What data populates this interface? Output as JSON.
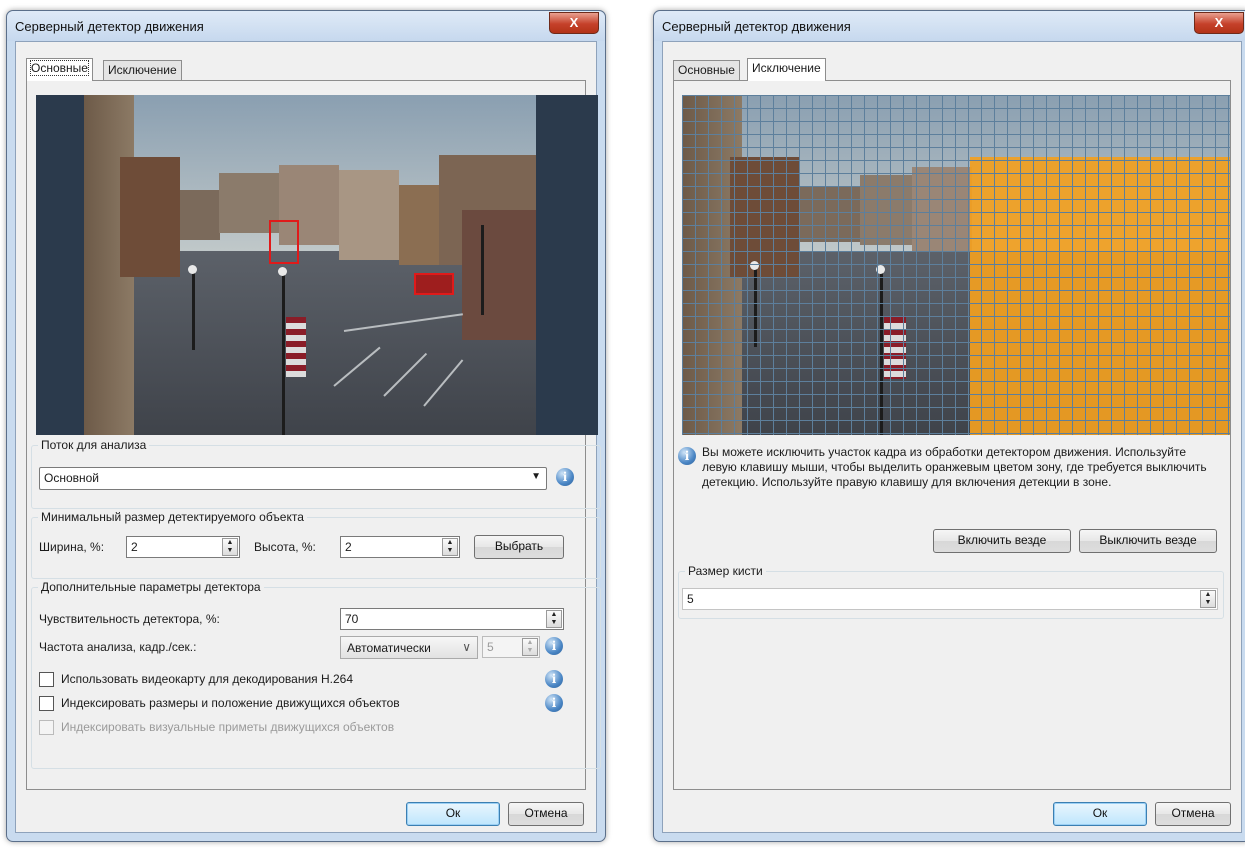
{
  "dialog_left": {
    "title": "Серверный детектор движения",
    "close_label": "X",
    "tabs": [
      "Основные",
      "Исключение"
    ],
    "stream_group": {
      "title": "Поток для анализа",
      "selected": "Основной"
    },
    "min_size_group": {
      "title": "Минимальный размер детектируемого объекта",
      "width_label": "Ширина, %:",
      "width_value": "2",
      "height_label": "Высота, %:",
      "height_value": "2",
      "choose_button": "Выбрать"
    },
    "extra_group": {
      "title": "Дополнительные параметры детектора",
      "sensitivity_label": "Чувствительность детектора, %:",
      "sensitivity_value": "70",
      "frequency_label": "Частота анализа, кадр./сек.:",
      "frequency_mode": "Автоматически",
      "frequency_value": "5",
      "checkbox_gpu": "Использовать видеокарту для декодирования H.264",
      "checkbox_index_size": "Индексировать размеры и положение движущихся объектов",
      "checkbox_index_visual": "Индексировать визуальные приметы движущихся объектов"
    },
    "ok_button": "Ок",
    "cancel_button": "Отмена"
  },
  "dialog_right": {
    "title": "Серверный детектор движения",
    "close_label": "X",
    "tabs": [
      "Основные",
      "Исключение"
    ],
    "info_text": "Вы можете исключить участок кадра из обработки детектором движения. Используйте левую клавишу мыши, чтобы выделить оранжевым цветом зону, где требуется выключить детекцию. Используйте правую клавишу для включения детекции в зоне.",
    "enable_all_button": "Включить везде",
    "disable_all_button": "Выключить везде",
    "brush_group": {
      "title": "Размер кисти",
      "value": "5"
    },
    "ok_button": "Ок",
    "cancel_button": "Отмена"
  },
  "colors": {
    "exclusion_zone": "#f2a020",
    "grid_lines": "#5d7f9c",
    "detection_box": "#e01a1a"
  }
}
